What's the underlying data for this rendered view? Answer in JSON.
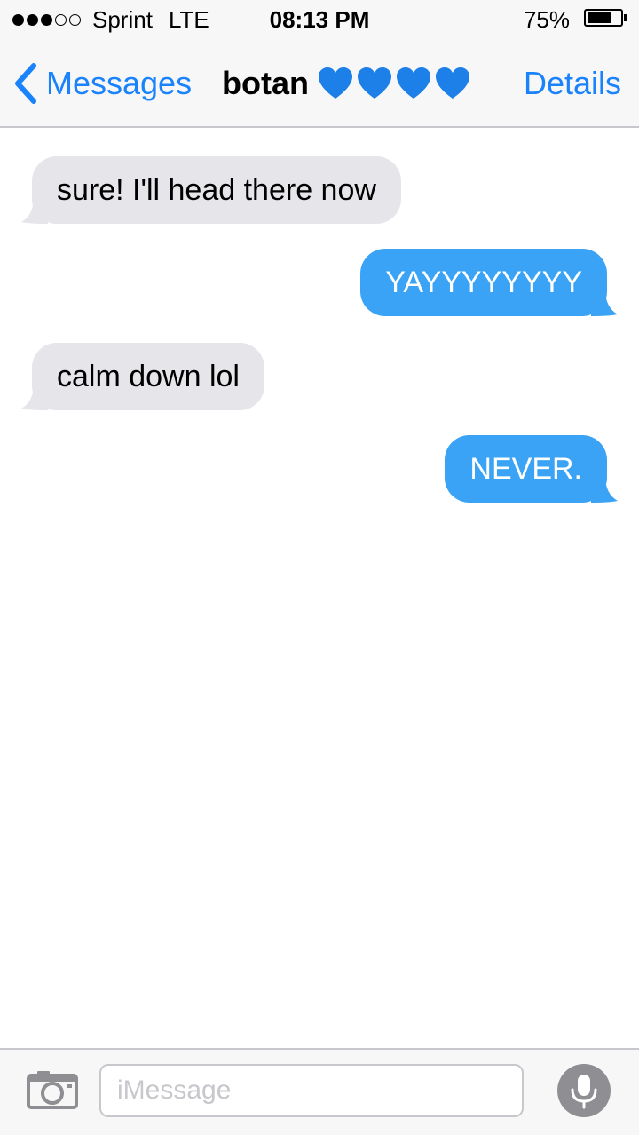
{
  "status_bar": {
    "signal_bars_filled": 3,
    "signal_bars_total": 5,
    "carrier": "Sprint",
    "network": "LTE",
    "time": "08:13 PM",
    "battery_percent": "75%",
    "battery_level": 0.75
  },
  "nav": {
    "back_label": "Messages",
    "contact_name": "botan",
    "contact_emoji_count": 4,
    "details_label": "Details"
  },
  "messages": [
    {
      "direction": "received",
      "text": "sure! I'll head there now"
    },
    {
      "direction": "sent",
      "text": "YAYYYYYYYY"
    },
    {
      "direction": "received",
      "text": "calm down lol"
    },
    {
      "direction": "sent",
      "text": "NEVER."
    }
  ],
  "composer": {
    "placeholder": "iMessage",
    "value": ""
  },
  "colors": {
    "accent": "#1a82fb",
    "sent_bubble": "#3aa3f5",
    "received_bubble": "#e5e5ea",
    "heart": "#1d7fe8"
  },
  "icons": {
    "back": "chevron-left-icon",
    "camera": "camera-icon",
    "mic": "microphone-icon",
    "heart": "blue-heart-icon"
  }
}
